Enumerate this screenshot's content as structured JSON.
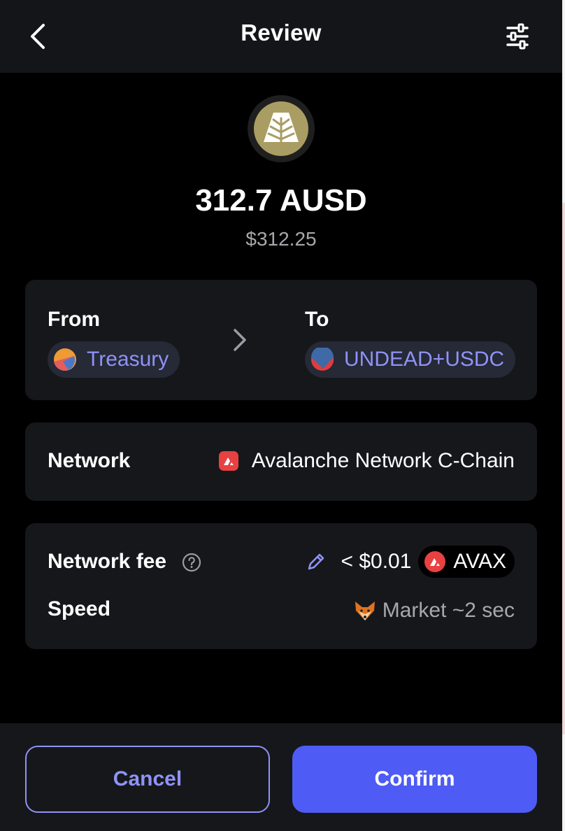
{
  "header": {
    "title": "Review"
  },
  "token": {
    "amount": "312.7 AUSD",
    "usd_value": "$312.25",
    "logo_color": "#a99d63"
  },
  "transfer": {
    "from_label": "From",
    "from_account": "Treasury",
    "to_label": "To",
    "to_account": "UNDEAD+USDC"
  },
  "network": {
    "label": "Network",
    "value": "Avalanche Network C-Chain",
    "icon": "avalanche-icon"
  },
  "fee": {
    "label": "Network fee",
    "value": "< $0.01",
    "token": "AVAX",
    "speed_label": "Speed",
    "speed_value": "Market ~2 sec"
  },
  "actions": {
    "cancel_label": "Cancel",
    "confirm_label": "Confirm"
  },
  "colors": {
    "accent": "#4e5bf5",
    "link": "#8f93f5",
    "card": "#16171b",
    "avalanche_red": "#e84142"
  }
}
